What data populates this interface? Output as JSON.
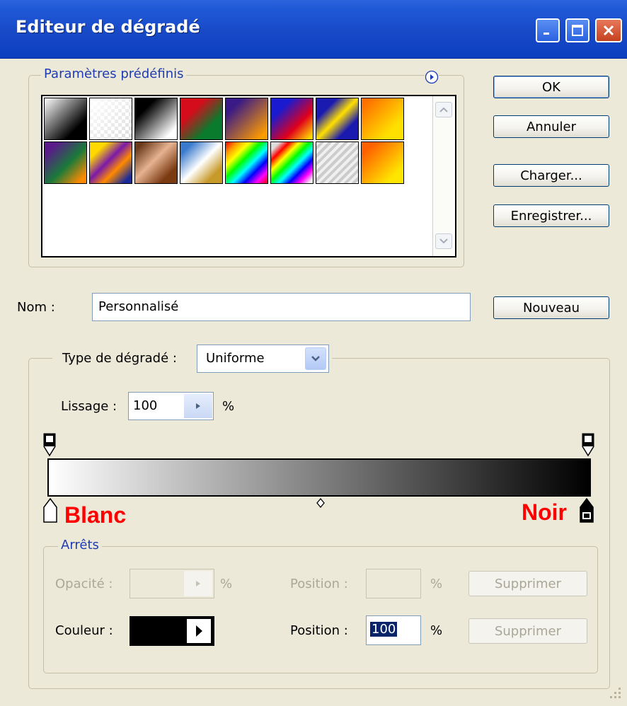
{
  "window": {
    "title": "Editeur de dégradé",
    "controls": [
      "minimize",
      "maximize",
      "close"
    ]
  },
  "presets": {
    "legend": "Paramètres prédéfinis",
    "menu_icon": "arrow-right-circle-icon",
    "swatches": [
      "linear-gradient(135deg,#ffffff 0%,#000000 75%)",
      "linear-gradient(135deg,#ffffff 0%,rgba(255,255,255,0) 100%)",
      "linear-gradient(135deg,#000000 25%,#ffffff 85%)",
      "linear-gradient(135deg,#d40c1c 30%,#0a7a2c 70%)",
      "linear-gradient(135deg,#3a1a86 20%,#ff9d00 90%)",
      "linear-gradient(135deg,#1a1ad0 25%,#e0001a 65%,#ffd800 95%)",
      "linear-gradient(135deg,#1a1ab0 25%,#ffe000 50%,#1a1ab0 75%)",
      "linear-gradient(135deg,#ff7000 10%,#ffe100 75%)",
      "linear-gradient(135deg,#5a1a8a 15%,#1a7a3a 55%,#ff8a00 90%)",
      "linear-gradient(135deg,#ffd800 20%,#7a1aa8 45%,#ff8a00 65%,#1a2a9a 90%)",
      "linear-gradient(135deg,#6a3a1a 10%,#e6b290 45%,#7a3a12 80%)",
      "linear-gradient(135deg,#3a7acc 15%,#ffffff 50%,#c89a2a 80%)",
      "linear-gradient(135deg,#ff0000,#ff9900,#ffff00,#00ff00,#00ffff,#0000ff,#ff00ff,#ff0000)",
      "linear-gradient(135deg,#ddd 10%,#ff0000,#ffff00,#00ff00,#00ffff,#0000ff,#ff00ff,#eee 95%)",
      "repeating-linear-gradient(135deg,#f0f0f0 0 4px,#cccccc 4px 8px)",
      "linear-gradient(135deg,#ff6000 15%,#ffe600 80%)"
    ]
  },
  "buttons": {
    "ok": "OK",
    "cancel": "Annuler",
    "load": "Charger...",
    "save": "Enregistrer...",
    "new": "Nouveau"
  },
  "name": {
    "label": "Nom :",
    "value": "Personnalisé"
  },
  "gradient": {
    "type_label": "Type de dégradé :",
    "type_value": "Uniforme",
    "smoothness_label": "Lissage :",
    "smoothness_value": "100",
    "percent": "%",
    "start_color": "#ffffff",
    "end_color": "#000000",
    "annotation_left": "Blanc",
    "annotation_right": "Noir",
    "annotation_color": "#ff0000"
  },
  "stops": {
    "legend": "Arrêts",
    "opacity_label": "Opacité :",
    "opacity_value": "",
    "opacity_position_label": "Position :",
    "opacity_position_value": "",
    "opacity_delete": "Supprimer",
    "color_label": "Couleur :",
    "color_value": "#000000",
    "color_position_label": "Position :",
    "color_position_value": "100",
    "color_delete": "Supprimer",
    "percent": "%"
  }
}
